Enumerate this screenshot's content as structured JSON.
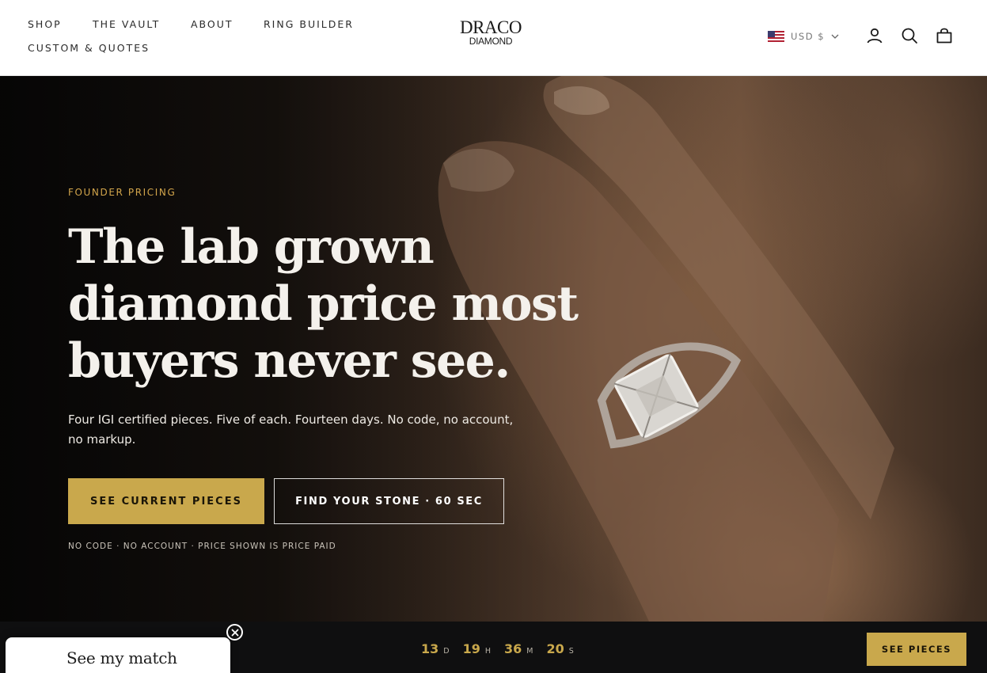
{
  "header": {
    "nav": [
      "SHOP",
      "THE VAULT",
      "ABOUT",
      "RING BUILDER",
      "CUSTOM & QUOTES"
    ],
    "logo": {
      "line1": "DRACO",
      "line2": "DIAMOND"
    },
    "currency": "USD $",
    "icons": [
      "account-icon",
      "search-icon",
      "cart-icon"
    ]
  },
  "hero": {
    "eyebrow": "FOUNDER PRICING",
    "headline_lines": [
      "The lab grown",
      "diamond price most",
      "buyers never see."
    ],
    "subcopy": "Four IGI certified pieces. Five of each. Fourteen days. No code, no account, no markup.",
    "primary_cta": "SEE CURRENT PIECES",
    "secondary_cta": "FIND YOUR STONE · 60 SEC",
    "fine_print": "NO CODE · NO ACCOUNT · PRICE SHOWN IS PRICE PAID"
  },
  "countdown": {
    "days": "13",
    "days_unit": "D",
    "hours": "19",
    "hours_unit": "H",
    "minutes": "36",
    "minutes_unit": "M",
    "seconds": "20",
    "seconds_unit": "S"
  },
  "bottom_bar": {
    "cta": "SEE PIECES"
  },
  "popup": {
    "title": "See my match"
  },
  "colors": {
    "gold": "#c9a84c",
    "eyebrow_gold": "#d2a54b",
    "bar": "#0f0f10"
  }
}
